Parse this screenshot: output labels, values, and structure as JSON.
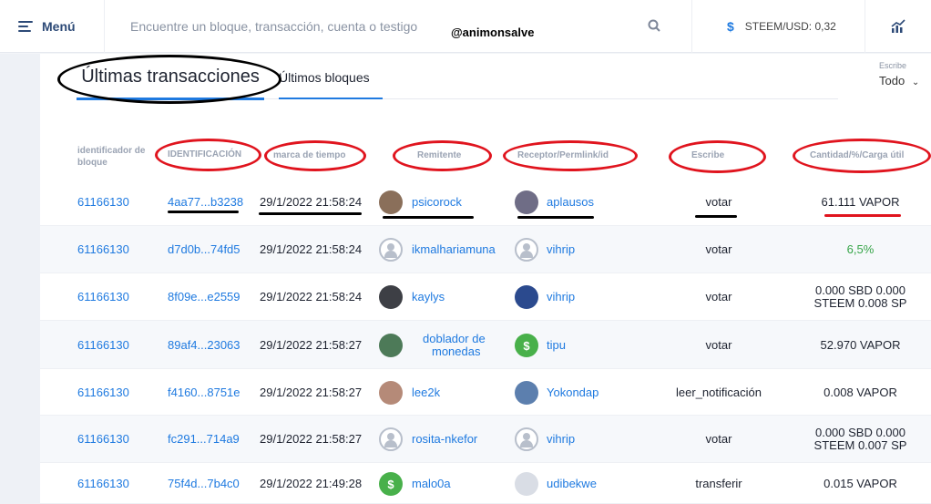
{
  "header": {
    "menu_label": "Menú",
    "search_placeholder": "Encuentre un bloque, transacción, cuenta o testigo",
    "watermark": "@animonsalve",
    "price_label": "STEEM/USD: 0,32",
    "currency_symbol": "$"
  },
  "tabs": {
    "transactions": "Últimas transacciones",
    "blocks": "Últimos bloques"
  },
  "filter": {
    "label": "Escribe",
    "value": "Todo"
  },
  "columns": {
    "block_id": "identificador de bloque",
    "identification": "IDENTIFICACIÓN",
    "timestamp": "marca de tiempo",
    "sender": "Remitente",
    "receiver": "Receptor/Permlink/id",
    "type": "Escribe",
    "amount": "Cantidad/%/Carga útil"
  },
  "rows": [
    {
      "block": "61166130",
      "id": "4aa77...b3238",
      "time": "29/1/2022 21:58:24",
      "sender": "psicorock",
      "receiver": "aplausos",
      "type": "votar",
      "amount": "61.111 VAPOR",
      "amount2": ""
    },
    {
      "block": "61166130",
      "id": "d7d0b...74fd5",
      "time": "29/1/2022 21:58:24",
      "sender": "ikmalhariamuna",
      "receiver": "vihrip",
      "type": "votar",
      "amount": "6,5%",
      "amount2": ""
    },
    {
      "block": "61166130",
      "id": "8f09e...e2559",
      "time": "29/1/2022 21:58:24",
      "sender": "kaylys",
      "receiver": "vihrip",
      "type": "votar",
      "amount": "0.000 SBD 0.000",
      "amount2": "STEEM 0.008 SP"
    },
    {
      "block": "61166130",
      "id": "89af4...23063",
      "time": "29/1/2022 21:58:27",
      "sender": "doblador de",
      "sender2": "monedas",
      "receiver": "tipu",
      "type": "votar",
      "amount": "52.970 VAPOR",
      "amount2": ""
    },
    {
      "block": "61166130",
      "id": "f4160...8751e",
      "time": "29/1/2022 21:58:27",
      "sender": "lee2k",
      "receiver": "Yokondap",
      "type": "leer_notificación",
      "amount": "0.008 VAPOR",
      "amount2": ""
    },
    {
      "block": "61166130",
      "id": "fc291...714a9",
      "time": "29/1/2022 21:58:27",
      "sender": "rosita-nkefor",
      "receiver": "vihrip",
      "type": "votar",
      "amount": "0.000 SBD 0.000",
      "amount2": "STEEM 0.007 SP"
    },
    {
      "block": "61166130",
      "id": "75f4d...7b4c0",
      "time": "29/1/2022 21:49:28",
      "sender": "malo0a",
      "receiver": "udibekwe",
      "type": "transferir",
      "amount": "0.015 VAPOR",
      "amount2": ""
    }
  ]
}
